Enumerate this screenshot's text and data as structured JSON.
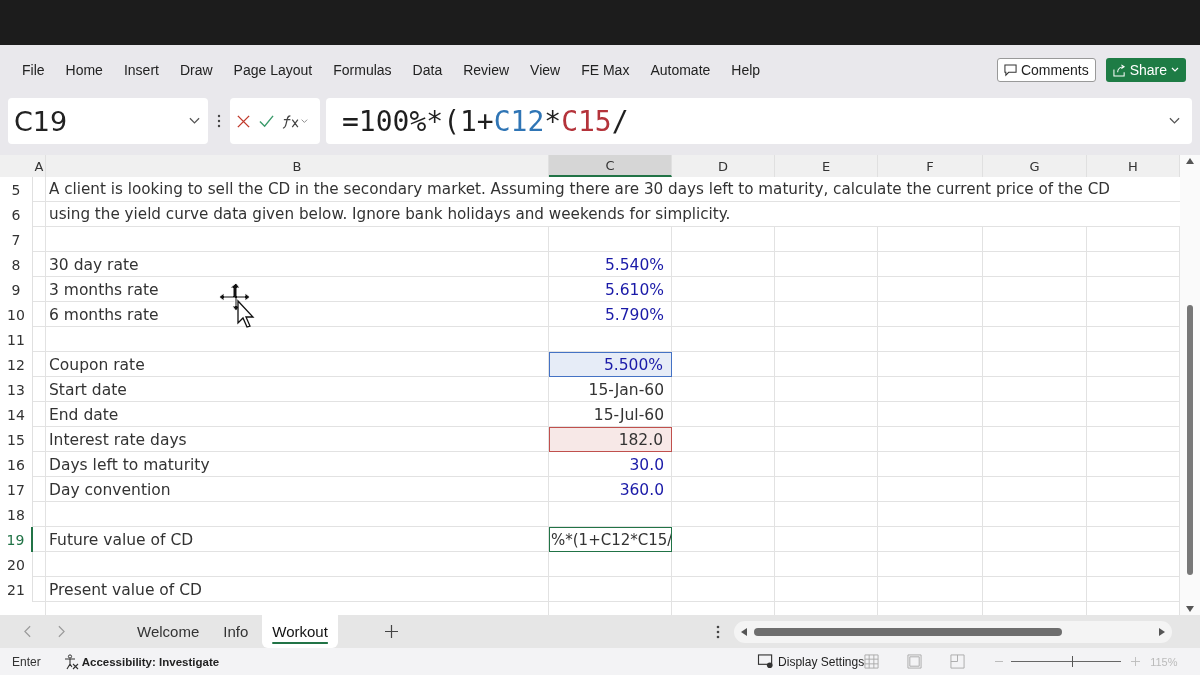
{
  "menu": [
    {
      "label": "File"
    },
    {
      "label": "Home"
    },
    {
      "label": "Insert"
    },
    {
      "label": "Draw"
    },
    {
      "label": "Page Layout"
    },
    {
      "label": "Formulas"
    },
    {
      "label": "Data"
    },
    {
      "label": "Review"
    },
    {
      "label": "View"
    },
    {
      "label": "FE Max"
    },
    {
      "label": "Automate"
    },
    {
      "label": "Help"
    }
  ],
  "comments_button": "Comments",
  "share_button": "Share",
  "name_box": "C19",
  "formula": [
    {
      "text": "=100%*(1+",
      "color": "#1f1f1f"
    },
    {
      "text": "C12",
      "color": "#2f75b5"
    },
    {
      "text": "*",
      "color": "#1f1f1f"
    },
    {
      "text": "C15",
      "color": "#b4333a"
    },
    {
      "text": "/",
      "color": "#1f1f1f"
    }
  ],
  "columns": [
    {
      "label": "A",
      "selected": false
    },
    {
      "label": "B",
      "selected": false
    },
    {
      "label": "C",
      "selected": true
    },
    {
      "label": "D",
      "selected": false
    },
    {
      "label": "E",
      "selected": false
    },
    {
      "label": "F",
      "selected": false
    },
    {
      "label": "G",
      "selected": false
    },
    {
      "label": "H",
      "selected": false
    }
  ],
  "rows": [
    {
      "number": "5",
      "selected": false,
      "kind": "note",
      "text": "A client is looking to sell the CD in the secondary market. Assuming there are 30 days left to maturity, calculate the current price of the CD"
    },
    {
      "number": "6",
      "selected": false,
      "kind": "note",
      "text": "using the yield curve data given below. Ignore bank holidays and weekends for simplicity."
    },
    {
      "number": "7",
      "selected": false,
      "kind": "blank"
    },
    {
      "number": "8",
      "selected": false,
      "kind": "input",
      "label": "30 day rate",
      "value": "5.540%"
    },
    {
      "number": "9",
      "selected": false,
      "kind": "input",
      "label": "3 months rate",
      "value": "5.610%"
    },
    {
      "number": "10",
      "selected": false,
      "kind": "input",
      "label": "6 months rate",
      "value": "5.790%"
    },
    {
      "number": "11",
      "selected": false,
      "kind": "blank"
    },
    {
      "number": "12",
      "selected": false,
      "kind": "input",
      "label": "Coupon rate",
      "value": "5.500%",
      "color": "#4472c4"
    },
    {
      "number": "13",
      "selected": false,
      "kind": "calc",
      "label": "Start date",
      "value": "15-Jan-60"
    },
    {
      "number": "14",
      "selected": false,
      "kind": "calc",
      "label": "End date",
      "value": "15-Jul-60"
    },
    {
      "number": "15",
      "selected": false,
      "kind": "calc",
      "label": "Interest rate days",
      "value": "182.0",
      "color": "#c0504d"
    },
    {
      "number": "16",
      "selected": false,
      "kind": "input",
      "label": "Days left to maturity",
      "value": "30.0"
    },
    {
      "number": "17",
      "selected": false,
      "kind": "input",
      "label": "Day convention",
      "value": "360.0"
    },
    {
      "number": "18",
      "selected": false,
      "kind": "blank"
    },
    {
      "number": "19",
      "selected": true,
      "kind": "editing",
      "label": "Future value of CD",
      "value": "%*(1+C12*C15/"
    },
    {
      "number": "20",
      "selected": false,
      "kind": "blank"
    },
    {
      "number": "21",
      "selected": false,
      "kind": "calc",
      "label": "Present value of CD"
    }
  ],
  "sheet_tabs": [
    {
      "label": "Welcome",
      "selected": false
    },
    {
      "label": "Info",
      "selected": false
    },
    {
      "label": "Workout",
      "selected": true
    }
  ],
  "status": {
    "mode": "Enter",
    "accessibility": "Accessibility: Investigate",
    "display_settings": "Display Settings",
    "zoom": "115%",
    "zoom_slider": {
      "level": 0.55
    }
  }
}
